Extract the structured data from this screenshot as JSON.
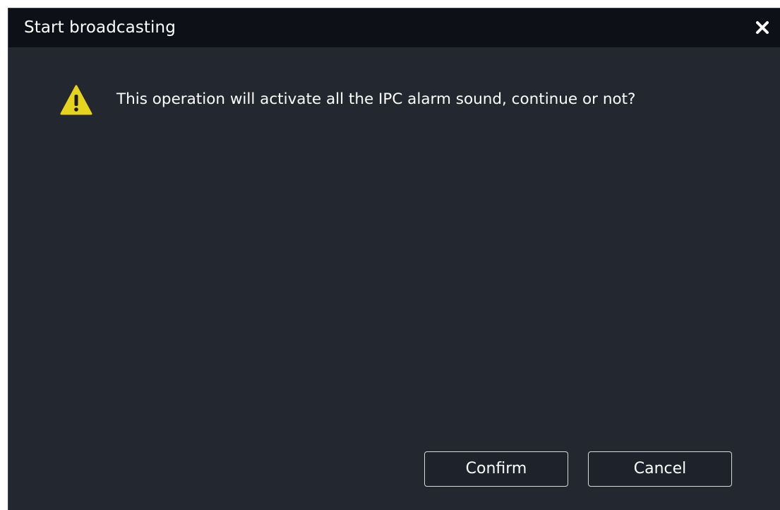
{
  "dialog": {
    "title": "Start broadcasting",
    "close_icon": "close-icon",
    "message": "This operation will activate all the IPC alarm sound, continue or not?",
    "message_icon": "warning-icon",
    "confirm_label": "Confirm",
    "cancel_label": "Cancel"
  },
  "colors": {
    "dialog_background": "#222730",
    "titlebar_background": "#0d1117",
    "warning_yellow": "#e6d31f",
    "text": "#ffffff",
    "button_border": "#d6d8db"
  }
}
